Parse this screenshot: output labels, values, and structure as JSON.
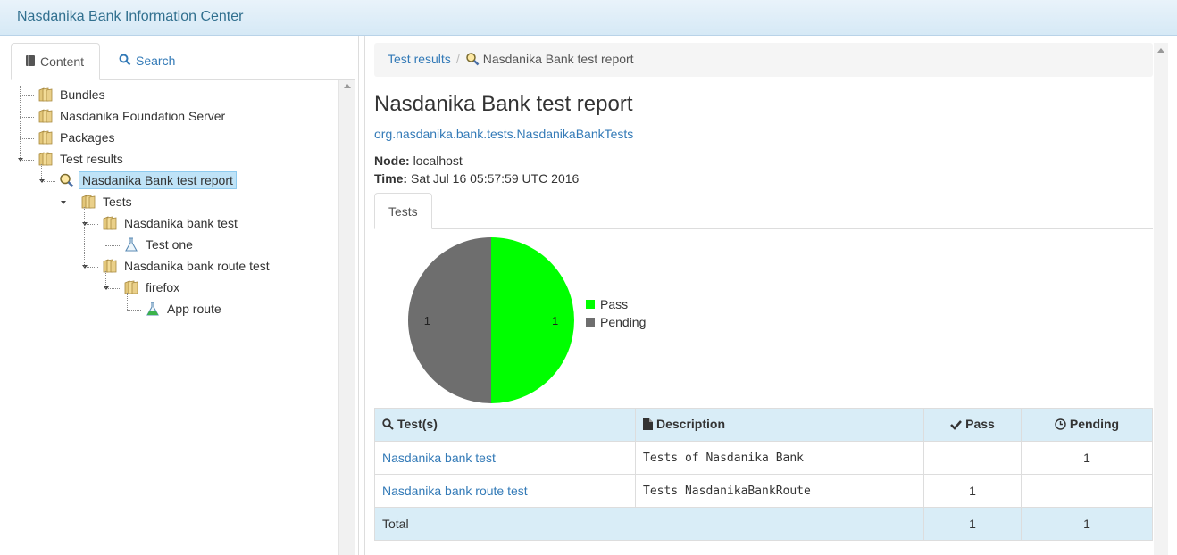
{
  "app": {
    "title": "Nasdanika Bank Information Center"
  },
  "left": {
    "tabs": [
      {
        "label": "Content",
        "icon": "book-icon"
      },
      {
        "label": "Search",
        "icon": "search-icon"
      }
    ],
    "tree": [
      {
        "label": "Bundles",
        "icon": "folder-icon"
      },
      {
        "label": "Nasdanika Foundation Server",
        "icon": "folder-icon"
      },
      {
        "label": "Packages",
        "icon": "folder-icon"
      },
      {
        "label": "Test results",
        "icon": "folder-icon"
      },
      {
        "label": "Nasdanika Bank test report",
        "icon": "magnifier-icon",
        "selected": true
      },
      {
        "label": "Tests",
        "icon": "folder-icon"
      },
      {
        "label": "Nasdanika bank test",
        "icon": "folder-icon"
      },
      {
        "label": "Test one",
        "icon": "flask-icon"
      },
      {
        "label": "Nasdanika bank route test",
        "icon": "folder-icon"
      },
      {
        "label": "firefox",
        "icon": "folder-icon"
      },
      {
        "label": "App route",
        "icon": "flask-green-icon"
      }
    ]
  },
  "breadcrumb": {
    "parent": "Test results",
    "separator": "/",
    "current": "Nasdanika Bank test report"
  },
  "report": {
    "title": "Nasdanika Bank test report",
    "class_name": "org.nasdanika.bank.tests.NasdanikaBankTests",
    "node_label": "Node:",
    "node_value": "localhost",
    "time_label": "Time:",
    "time_value": "Sat Jul 16 05:57:59 UTC 2016",
    "tab": "Tests"
  },
  "chart_data": {
    "type": "pie",
    "title": "",
    "slices": [
      {
        "name": "Pass",
        "value": 1,
        "color": "#00ff00"
      },
      {
        "name": "Pending",
        "value": 1,
        "color": "#6e6e6e"
      }
    ],
    "legend_position": "right"
  },
  "table": {
    "headers": {
      "tests": "Test(s)",
      "description": "Description",
      "pass": "Pass",
      "pending": "Pending"
    },
    "rows": [
      {
        "test": "Nasdanika bank test",
        "description": "Tests of Nasdanika Bank",
        "pass": "",
        "pending": "1"
      },
      {
        "test": "Nasdanika bank route test",
        "description": "Tests NasdanikaBankRoute",
        "pass": "1",
        "pending": ""
      }
    ],
    "total": {
      "label": "Total",
      "pass": "1",
      "pending": "1"
    }
  },
  "colors": {
    "header_bg": "#d6e9f6",
    "link": "#337ab7",
    "table_header_bg": "#d9edf7",
    "selected_bg": "#bfe3f7"
  }
}
